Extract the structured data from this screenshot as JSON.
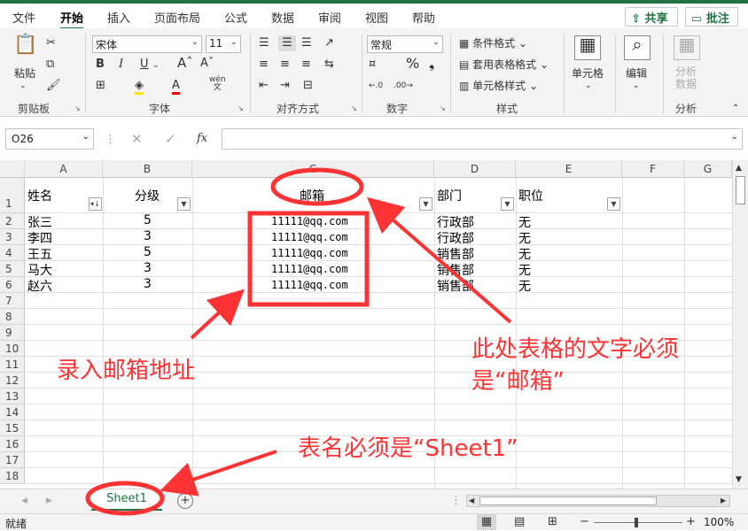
{
  "ribbon_tabs": [
    "文件",
    "开始",
    "插入",
    "页面布局",
    "公式",
    "数据",
    "审阅",
    "视图",
    "帮助"
  ],
  "active_tab": "开始",
  "share_label": "共享",
  "comment_label": "批注",
  "clipboard": {
    "paste_label": "粘贴",
    "group_label": "剪贴板"
  },
  "font": {
    "name": "宋体",
    "size": "11",
    "group_label": "字体",
    "bold": "B",
    "italic": "I",
    "underline": "U",
    "wen": "wén"
  },
  "alignment": {
    "group_label": "对齐方式"
  },
  "number": {
    "format": "常规",
    "group_label": "数字"
  },
  "styles": {
    "conditional": "条件格式",
    "table": "套用表格格式",
    "cell": "单元格样式",
    "group_label": "样式"
  },
  "cells": {
    "label": "单元格"
  },
  "editing": {
    "label": "编辑"
  },
  "analysis": {
    "label": "分析数据",
    "group_label": "分析"
  },
  "name_box": "O26",
  "formula_value": "",
  "columns": [
    "A",
    "B",
    "C",
    "D",
    "E",
    "F",
    "G"
  ],
  "rows": [
    "1",
    "2",
    "3",
    "4",
    "5",
    "6",
    "7",
    "8",
    "9",
    "10",
    "11",
    "12",
    "13",
    "14",
    "15",
    "16",
    "17",
    "18"
  ],
  "header_row": {
    "name": "姓名",
    "level": "分级",
    "email": "邮箱",
    "dept": "部门",
    "position": "职位"
  },
  "data_rows": [
    {
      "name": "张三",
      "level": "5",
      "email": "11111@qq.com",
      "dept": "行政部",
      "position": "无"
    },
    {
      "name": "李四",
      "level": "3",
      "email": "11111@qq.com",
      "dept": "行政部",
      "position": "无"
    },
    {
      "name": "王五",
      "level": "5",
      "email": "11111@qq.com",
      "dept": "销售部",
      "position": "无"
    },
    {
      "name": "马大",
      "level": "3",
      "email": "11111@qq.com",
      "dept": "销售部",
      "position": "无"
    },
    {
      "name": "赵六",
      "level": "3",
      "email": "11111@qq.com",
      "dept": "销售部",
      "position": "无"
    }
  ],
  "sheet_tab": "Sheet1",
  "status_text": "就绪",
  "zoom": "100%",
  "annotations": {
    "enter_email": "录入邮箱地址",
    "header_must_line1": "此处表格的文字必须",
    "header_must_line2": "是“邮箱”",
    "sheet_must": "表名必须是“Sheet1”"
  },
  "colors": {
    "accent": "#217346",
    "annotation": "#ff3333"
  }
}
